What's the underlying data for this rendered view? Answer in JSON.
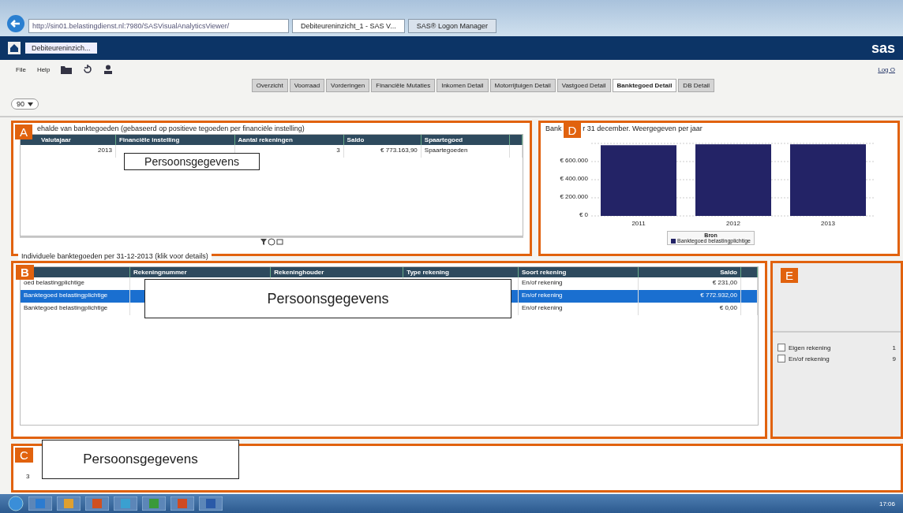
{
  "browser": {
    "address": "http://sin01.belastingdienst.nl:7980/SASVisualAnalyticsViewer/",
    "tabs": [
      {
        "label": "Debiteureninzicht_1 - SAS V...",
        "selected": true
      },
      {
        "label": "SAS® Logon Manager",
        "selected": false
      }
    ]
  },
  "app": {
    "tab": "Debiteureninzich...",
    "logo": "sas"
  },
  "menu": [
    "File",
    "Help"
  ],
  "log_off": "Log O",
  "report_tabs": [
    {
      "label": "Overzicht",
      "selected": false
    },
    {
      "label": "Voorraad",
      "selected": false
    },
    {
      "label": "Vorderingen",
      "selected": false
    },
    {
      "label": "Financiële Mutaties",
      "selected": false
    },
    {
      "label": "Inkomen Detail",
      "selected": false
    },
    {
      "label": "Motorrijtuigen Detail",
      "selected": false
    },
    {
      "label": "Vastgoed Detail",
      "selected": false
    },
    {
      "label": "Banktegoed Detail",
      "selected": true
    },
    {
      "label": "DB Detail",
      "selected": false
    }
  ],
  "zoom_control": {
    "value": "90"
  },
  "panel_a": {
    "marker": "A",
    "redaction": "Persoonsgegevens",
    "title": "ehalde van banktegoeden (gebaseerd op positieve tegoeden per financiële instelling)",
    "columns": [
      "Valutajaar",
      "Financiële instelling",
      "Aantal rekeningen",
      "Saldo",
      "Spaartegoed"
    ],
    "rows": [
      {
        "year": "2013",
        "count": "3",
        "balance": "€ 773.163,90",
        "kind": "Spaartegoeden"
      }
    ]
  },
  "panel_d": {
    "marker": "D",
    "title_start": "Bank",
    "title_end": "r 31 december. Weergegeven per jaar",
    "chart_data": {
      "type": "bar",
      "categories": [
        "2011",
        "2012",
        "2013"
      ],
      "series": [
        {
          "name": "Banktegoed belastingplichtige",
          "color": "#232366",
          "values": [
            780000,
            790000,
            790000
          ]
        }
      ],
      "ylim": [
        0,
        800000
      ],
      "grid": true,
      "yticks": [
        {
          "value": 0,
          "label": "€ 0"
        },
        {
          "value": 200000,
          "label": "€ 200.000"
        },
        {
          "value": 400000,
          "label": "€ 400.000"
        },
        {
          "value": 600000,
          "label": "€ 600.000"
        }
      ],
      "legend_title": "Bron"
    }
  },
  "panel_b": {
    "marker": "B",
    "redaction": "Persoonsgegevens",
    "title": "Individuele banktegoeden per 31-12-2013 (klik voor details)",
    "columns": [
      "Rekeningnummer",
      "Rekeninghouder",
      "Type rekening",
      "Soort rekening",
      "Saldo"
    ],
    "rows": [
      {
        "source": "oed belastingplichtige",
        "type": "En/of rekening",
        "balance": "€ 231,00",
        "selected": false
      },
      {
        "source": "Banktegoed belastingplichtige",
        "type": "En/of rekening",
        "balance": "€ 772.932,00",
        "selected": true
      },
      {
        "source": "Banktegoed belastingplichtige",
        "type": "En/of rekening",
        "balance": "€ 0,00",
        "selected": false
      }
    ]
  },
  "panel_e": {
    "marker": "E",
    "filters": [
      {
        "label": "Eigen rekening",
        "count": "1",
        "checked": false
      },
      {
        "label": "En/of rekening",
        "count": "9",
        "checked": false
      }
    ]
  },
  "panel_c": {
    "marker": "C",
    "value": "3",
    "redaction": "Persoonsgegevens"
  },
  "taskbar": {
    "clock": "17:06"
  }
}
